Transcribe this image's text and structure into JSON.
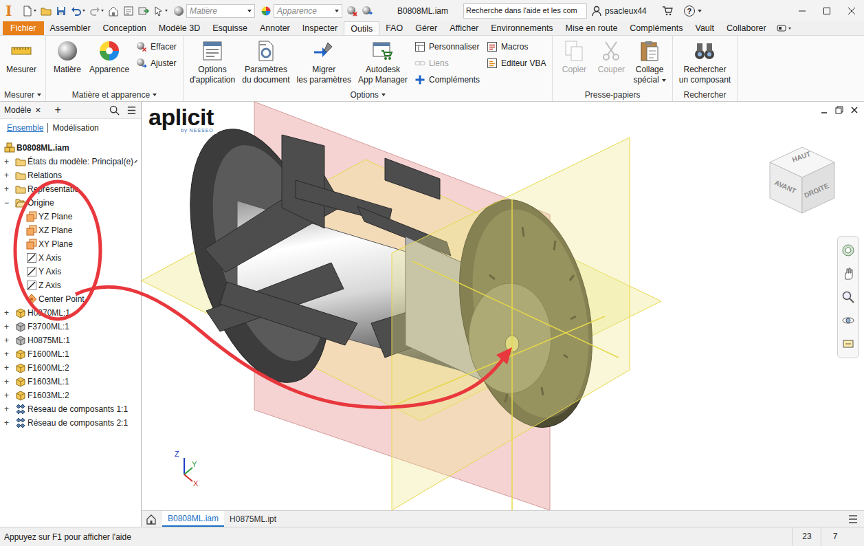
{
  "title_bar": {
    "app_letter": "I",
    "material": "Matière",
    "appearance": "Apparence",
    "document": "B0808ML.iam",
    "search": "Recherche dans l'aide et les com",
    "user": "psacleux44",
    "help": "?"
  },
  "ribbon_tabs": [
    {
      "label": "Fichier",
      "selected": false,
      "kind": "file"
    },
    {
      "label": "Assembler",
      "selected": false,
      "kind": "tab"
    },
    {
      "label": "Conception",
      "selected": false,
      "kind": "tab"
    },
    {
      "label": "Modèle 3D",
      "selected": false,
      "kind": "tab"
    },
    {
      "label": "Esquisse",
      "selected": false,
      "kind": "tab"
    },
    {
      "label": "Annoter",
      "selected": false,
      "kind": "tab"
    },
    {
      "label": "Inspecter",
      "selected": false,
      "kind": "tab"
    },
    {
      "label": "Outils",
      "selected": true,
      "kind": "tab"
    },
    {
      "label": "FAO",
      "selected": false,
      "kind": "tab"
    },
    {
      "label": "Gérer",
      "selected": false,
      "kind": "tab"
    },
    {
      "label": "Afficher",
      "selected": false,
      "kind": "tab"
    },
    {
      "label": "Environnements",
      "selected": false,
      "kind": "tab"
    },
    {
      "label": "Mise en route",
      "selected": false,
      "kind": "tab"
    },
    {
      "label": "Compléments",
      "selected": false,
      "kind": "tab"
    },
    {
      "label": "Vault",
      "selected": false,
      "kind": "tab"
    },
    {
      "label": "Collaborer",
      "selected": false,
      "kind": "tab"
    }
  ],
  "ribbon_groups": [
    {
      "label": "Mesurer",
      "dropdown": true,
      "columns": [
        [
          {
            "lines": [
              "Mesurer"
            ],
            "kind": "large",
            "disabled": false,
            "dropdown": false
          }
        ]
      ]
    },
    {
      "label": "Matière et apparence",
      "dropdown": true,
      "columns": [
        [
          {
            "lines": [
              "Matière"
            ],
            "kind": "large",
            "disabled": false,
            "dropdown": false
          }
        ],
        [
          {
            "lines": [
              "Apparence"
            ],
            "kind": "large",
            "disabled": false,
            "dropdown": false
          }
        ],
        [
          {
            "lines": [
              "Effacer"
            ],
            "kind": "small",
            "disabled": false,
            "dropdown": false
          },
          {
            "lines": [
              "Ajuster"
            ],
            "kind": "small",
            "disabled": false,
            "dropdown": false
          }
        ]
      ]
    },
    {
      "label": "Options",
      "dropdown": true,
      "columns": [
        [
          {
            "lines": [
              "Options",
              "d'application"
            ],
            "kind": "large",
            "disabled": false,
            "dropdown": false
          }
        ],
        [
          {
            "lines": [
              "Paramètres",
              "du document"
            ],
            "kind": "large",
            "disabled": false,
            "dropdown": false
          }
        ],
        [
          {
            "lines": [
              "Migrer",
              "les paramètres"
            ],
            "kind": "large",
            "disabled": false,
            "dropdown": false
          }
        ],
        [
          {
            "lines": [
              "Autodesk",
              "App Manager"
            ],
            "kind": "large",
            "disabled": false,
            "dropdown": false
          }
        ],
        [
          {
            "lines": [
              "Personnaliser"
            ],
            "kind": "small",
            "disabled": false,
            "dropdown": false
          },
          {
            "lines": [
              "Liens"
            ],
            "kind": "small",
            "disabled": true,
            "dropdown": false
          },
          {
            "lines": [
              "Compléments"
            ],
            "kind": "small",
            "disabled": false,
            "dropdown": false
          }
        ],
        [
          {
            "lines": [
              "Macros"
            ],
            "kind": "small",
            "disabled": false,
            "dropdown": false
          },
          {
            "lines": [
              "Editeur VBA"
            ],
            "kind": "small",
            "disabled": false,
            "dropdown": false
          }
        ]
      ]
    },
    {
      "label": "Presse-papiers",
      "dropdown": false,
      "columns": [
        [
          {
            "lines": [
              "Copier"
            ],
            "kind": "large",
            "disabled": true,
            "dropdown": false
          }
        ],
        [
          {
            "lines": [
              "Couper"
            ],
            "kind": "large",
            "disabled": true,
            "dropdown": false
          }
        ],
        [
          {
            "lines": [
              "Collage",
              "spécial"
            ],
            "kind": "large",
            "disabled": false,
            "dropdown": true
          }
        ]
      ]
    },
    {
      "label": "Rechercher",
      "dropdown": false,
      "columns": [
        [
          {
            "lines": [
              "Rechercher",
              "un composant"
            ],
            "kind": "large",
            "disabled": false,
            "dropdown": false
          }
        ]
      ]
    }
  ],
  "browser": {
    "tab": "Modèle",
    "close": "×",
    "add": "+",
    "subtabs": [
      {
        "label": "Ensemble",
        "selected": true
      },
      {
        "label": "Modélisation",
        "selected": false
      }
    ],
    "items": [
      {
        "label": "B0808ML.iam",
        "kind": "root",
        "depth": 0,
        "toggle": "",
        "expanded": true,
        "editable": false
      },
      {
        "label": "États du modèle: Principal(e)",
        "kind": "folder",
        "depth": 1,
        "toggle": "+",
        "expanded": false,
        "editable": true
      },
      {
        "label": "Relations",
        "kind": "folder",
        "depth": 1,
        "toggle": "+",
        "expanded": false,
        "editable": false
      },
      {
        "label": "Représentatio",
        "kind": "folder",
        "depth": 1,
        "toggle": "+",
        "expanded": false,
        "editable": false
      },
      {
        "label": "Origine",
        "kind": "folder-open",
        "depth": 1,
        "toggle": "−",
        "expanded": true,
        "editable": false
      },
      {
        "label": "YZ Plane",
        "kind": "plane",
        "depth": 2,
        "toggle": "",
        "expanded": false,
        "editable": false
      },
      {
        "label": "XZ Plane",
        "kind": "plane",
        "depth": 2,
        "toggle": "",
        "expanded": false,
        "editable": false
      },
      {
        "label": "XY Plane",
        "kind": "plane",
        "depth": 2,
        "toggle": "",
        "expanded": false,
        "editable": false
      },
      {
        "label": "X Axis",
        "kind": "axis",
        "depth": 2,
        "toggle": "",
        "expanded": false,
        "editable": false
      },
      {
        "label": "Y Axis",
        "kind": "axis",
        "depth": 2,
        "toggle": "",
        "expanded": false,
        "editable": false
      },
      {
        "label": "Z Axis",
        "kind": "axis",
        "depth": 2,
        "toggle": "",
        "expanded": false,
        "editable": false
      },
      {
        "label": "Center Point",
        "kind": "point",
        "depth": 2,
        "toggle": "",
        "expanded": false,
        "editable": false
      },
      {
        "label": "H0870ML:1",
        "kind": "part",
        "depth": 1,
        "toggle": "+",
        "expanded": false,
        "editable": false
      },
      {
        "label": "F3700ML:1",
        "kind": "part-grey",
        "depth": 1,
        "toggle": "+",
        "expanded": false,
        "editable": false
      },
      {
        "label": "H0875ML:1",
        "kind": "part-grey",
        "depth": 1,
        "toggle": "+",
        "expanded": false,
        "editable": false
      },
      {
        "label": "F1600ML:1",
        "kind": "part",
        "depth": 1,
        "toggle": "+",
        "expanded": false,
        "editable": false
      },
      {
        "label": "F1600ML:2",
        "kind": "part",
        "depth": 1,
        "toggle": "+",
        "expanded": false,
        "editable": false
      },
      {
        "label": "F1603ML:1",
        "kind": "part",
        "depth": 1,
        "toggle": "+",
        "expanded": false,
        "editable": false
      },
      {
        "label": "F1603ML:2",
        "kind": "part",
        "depth": 1,
        "toggle": "+",
        "expanded": false,
        "editable": false
      },
      {
        "label": "Réseau de composants 1:1",
        "kind": "pattern",
        "depth": 1,
        "toggle": "+",
        "expanded": false,
        "editable": false
      },
      {
        "label": "Réseau de composants 2:1",
        "kind": "pattern",
        "depth": 1,
        "toggle": "+",
        "expanded": false,
        "editable": false
      }
    ]
  },
  "viewport": {
    "logo": "aplicit",
    "logo_tagline": "by NESSEO",
    "view_cube": {
      "top": "HAUT",
      "front": "AVANT",
      "right": "DROITE"
    },
    "triad": {
      "x": "X",
      "y": "Y",
      "z": "Z"
    }
  },
  "document_tabs": [
    {
      "label": "B0808ML.iam",
      "selected": true
    },
    {
      "label": "H0875ML.ipt",
      "selected": false
    }
  ],
  "status_bar": {
    "message": "Appuyez sur F1 pour afficher l'aide",
    "fields": [
      "23",
      "7"
    ]
  }
}
